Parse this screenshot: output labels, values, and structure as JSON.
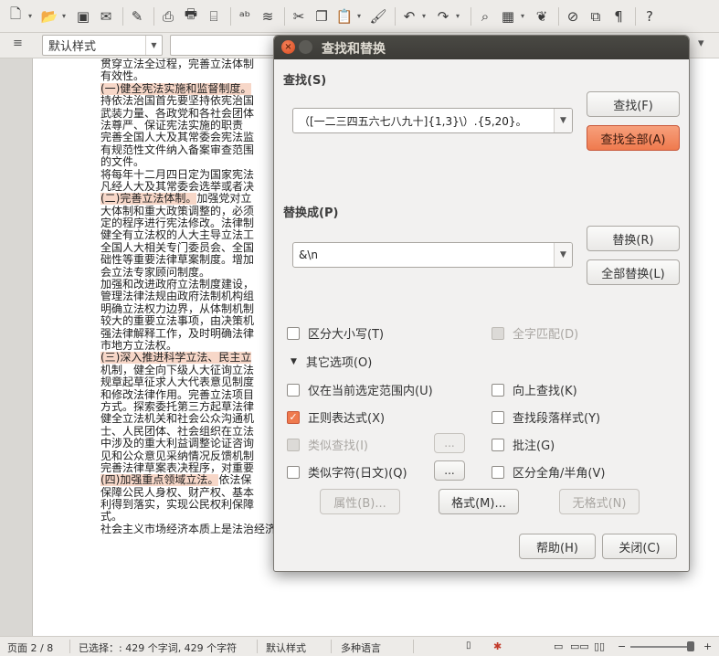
{
  "format_bar": {
    "paragraph_style": "默认样式"
  },
  "document": {
    "lines": [
      {
        "text": "贯穿立法全过程，完善立法体制",
        "highlight": ""
      },
      {
        "text": "有效性。",
        "highlight": ""
      },
      {
        "text": "",
        "highlight": "(一)健全宪法实施和监督制度。"
      },
      {
        "text": "持依法治国首先要坚持依宪治国",
        "highlight": ""
      },
      {
        "text": "武装力量、各政党和各社会团体",
        "highlight": ""
      },
      {
        "text": "法尊严、保证宪法实施的职责",
        "highlight": ""
      },
      {
        "text": "完善全国人大及其常委会宪法监",
        "highlight": ""
      },
      {
        "text": "有规范性文件纳入备案审查范围",
        "highlight": ""
      },
      {
        "text": "的文件。",
        "highlight": ""
      },
      {
        "text": "将每年十二月四日定为国家宪法",
        "highlight": ""
      },
      {
        "text": "凡经人大及其常委会选举或者决",
        "highlight": ""
      },
      {
        "text": "加强党对立",
        "highlight": "(二)完善立法体制。"
      },
      {
        "text": "大体制和重大政策调整的，必须",
        "highlight": ""
      },
      {
        "text": "定的程序进行宪法修改。法律制",
        "highlight": ""
      },
      {
        "text": "健全有立法权的人大主导立法工",
        "highlight": ""
      },
      {
        "text": "全国人大相关专门委员会、全国",
        "highlight": ""
      },
      {
        "text": "础性等重要法律草案制度。增加",
        "highlight": ""
      },
      {
        "text": "会立法专家顾问制度。",
        "highlight": ""
      },
      {
        "text": "加强和改进政府立法制度建设，",
        "highlight": ""
      },
      {
        "text": "管理法律法规由政府法制机构组",
        "highlight": ""
      },
      {
        "text": "明确立法权力边界，从体制机制",
        "highlight": ""
      },
      {
        "text": "较大的重要立法事项，由决策机",
        "highlight": ""
      },
      {
        "text": "强法律解释工作，及时明确法律",
        "highlight": ""
      },
      {
        "text": "市地方立法权。",
        "highlight": ""
      },
      {
        "text": "",
        "highlight": "(三)深入推进科学立法、民主立"
      },
      {
        "text": "机制，健全向下级人大征询立法",
        "highlight": ""
      },
      {
        "text": "规章起草征求人大代表意见制度",
        "highlight": ""
      },
      {
        "text": "和修改法律作用。完善立法项目",
        "highlight": ""
      },
      {
        "text": "方式。探索委托第三方起草法律",
        "highlight": ""
      },
      {
        "text": "健全立法机关和社会公众沟通机",
        "highlight": ""
      },
      {
        "text": "士、人民团体、社会组织在立法",
        "highlight": ""
      },
      {
        "text": "中涉及的重大利益调整论证咨询",
        "highlight": ""
      },
      {
        "text": "见和公众意见采纳情况反馈机制",
        "highlight": ""
      },
      {
        "text": "完善法律草案表决程序，对重要",
        "highlight": ""
      },
      {
        "text": "依法保",
        "highlight": "(四)加强重点领域立法。"
      },
      {
        "text": "保障公民人身权、财产权、基本",
        "highlight": ""
      },
      {
        "text": "利得到落实，实现公民权利保障",
        "highlight": ""
      },
      {
        "text": "式。",
        "highlight": ""
      },
      {
        "text": "社会主义市场经济本质上是法治经济。使市场在资源配置中起决定性作用和更好发挥政府作用，必须以",
        "highlight": ""
      }
    ]
  },
  "status_bar": {
    "page": "页面 2 / 8",
    "selection": "已选择：: 429 个字词, 429 个字符",
    "style": "默认样式",
    "language": "多种语言"
  },
  "dialog": {
    "title": "查找和替换",
    "find_label": "查找(S)",
    "find_value": "（[一二三四五六七八九十]{1,3}\\）.{5,20}。",
    "find_button": "查找(F)",
    "find_all_button": "查找全部(A)",
    "replace_label": "替换成(P)",
    "replace_value": "&\\n",
    "replace_button": "替换(R)",
    "replace_all_button": "全部替换(L)",
    "match_case": "区分大小写(T)",
    "whole_words": "全字匹配(D)",
    "other_options": "其它选项(O)",
    "current_selection_only": "仅在当前选定范围内(U)",
    "backwards": "向上查找(K)",
    "regex": "正则表达式(X)",
    "paragraph_styles": "查找段落样式(Y)",
    "similarity": "类似查找(I)",
    "comments": "批注(G)",
    "sounds_like": "类似字符(日文)(Q)",
    "match_width": "区分全角/半角(V)",
    "ellipsis": "...",
    "attributes_button": "属性(B)...",
    "format_button": "格式(M)...",
    "no_format_button": "无格式(N)",
    "help_button": "帮助(H)",
    "close_button": "关闭(C)",
    "states": {
      "match_case": false,
      "whole_words": false,
      "current_selection_only": false,
      "backwards": false,
      "regex": true,
      "paragraph_styles": false,
      "similarity": false,
      "comments": false,
      "sounds_like": false,
      "match_width": false
    }
  },
  "colors": {
    "accent": "#ef7a4e",
    "highlight": "#f7d7c8",
    "titlebar": "#3c3b37"
  }
}
